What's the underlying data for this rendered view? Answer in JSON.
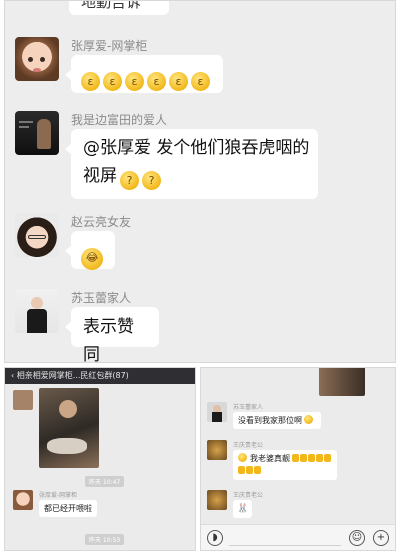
{
  "top_chat": {
    "partial_top_text": "地勤告诉",
    "messages": [
      {
        "sender": "张厚爱-网掌柜",
        "text": "",
        "emoji_count": 6
      },
      {
        "sender": "我是边富田的爱人",
        "line1": "@张厚爱 发个他们狼吞虎咽的",
        "line2": "视屏"
      },
      {
        "sender": "赵云亮女友",
        "text": ""
      },
      {
        "sender": "苏玉蕾家人",
        "text": "表示赞同"
      }
    ]
  },
  "bottom_left": {
    "header_title": "相亲相爱网掌柜...民红包群(87)",
    "time1": "昨天 10:47",
    "sender": "张厚爱-网掌柜",
    "message": "都已经开喂啦",
    "time2": "昨天 10:53"
  },
  "bottom_right": {
    "messages": [
      {
        "sender": "苏玉蕾家人",
        "text": "没看到我家那位啊"
      },
      {
        "sender": "王庆贵老公",
        "text": "我老婆真靓"
      },
      {
        "sender": "王庆贵老公",
        "text": ""
      }
    ],
    "voice_icon": "voice-icon",
    "emoji_icon": "emoji-icon",
    "plus_icon": "plus-icon"
  },
  "colors": {
    "chat_bg": "#ededed",
    "bubble_bg": "#ffffff",
    "name_gray": "#8a8a8a",
    "emoji_yellow": "#f2b81a"
  }
}
